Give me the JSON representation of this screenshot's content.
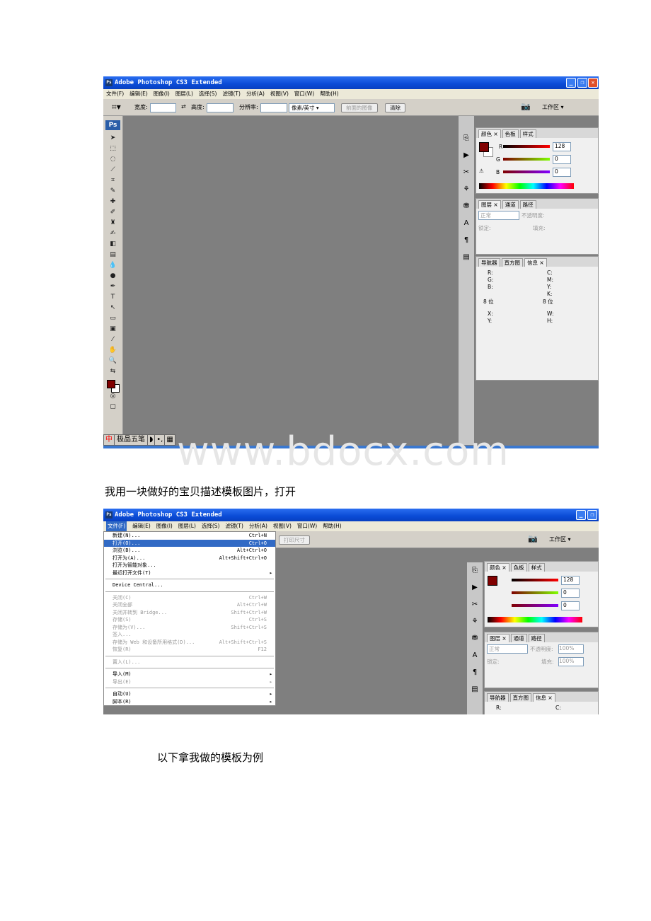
{
  "shot1": {
    "title": "Adobe Photoshop CS3 Extended",
    "menu": [
      "文件(F)",
      "编辑(E)",
      "图像(I)",
      "图层(L)",
      "选择(S)",
      "滤镜(T)",
      "分析(A)",
      "视图(V)",
      "窗口(W)",
      "帮助(H)"
    ],
    "options": {
      "width_label": "宽度:",
      "height_label": "高度:",
      "resolution_label": "分辨率:",
      "unit": "像素/英寸",
      "front_image": "前面的图像",
      "clear": "清除",
      "workspace": "工作区 ▾"
    },
    "ps_logo": "Ps",
    "color_panel": {
      "tabs": [
        "颜色 ×",
        "色板",
        "样式"
      ],
      "r_label": "R",
      "g_label": "G",
      "b_label": "B",
      "r": "128",
      "g": "0",
      "b": "0"
    },
    "layers_panel": {
      "tabs": [
        "图层 ×",
        "通道",
        "路径"
      ],
      "mode": "正常",
      "opacity_label": "不透明度:",
      "lock_label": "锁定:",
      "fill_label": "填充:"
    },
    "info_panel": {
      "tabs": [
        "导航器",
        "直方图",
        "信息 ×"
      ],
      "rgb": "R:\nG:\nB:",
      "cmyk": "C:\nM:\nY:\nK:",
      "bits1": "8 位",
      "bits2": "8 位",
      "xy": "X:\nY:",
      "wh": "W:\nH:"
    },
    "ime": {
      "zh": "中",
      "name": "极品五笔"
    }
  },
  "watermark": "www.bdocx.com",
  "para1": "我用一块做好的宝贝描述模板图片，打开",
  "shot2": {
    "title": "Adobe Photoshop CS3 Extended",
    "menu": [
      "文件(F)",
      "编辑(E)",
      "图像(I)",
      "图层(L)",
      "选择(S)",
      "滤镜(T)",
      "分析(A)",
      "视图(V)",
      "窗口(W)",
      "帮助(H)"
    ],
    "print_size": "打印尺寸",
    "workspace": "工作区 ▾",
    "file_menu": [
      {
        "label": "新建(N)...",
        "shortcut": "Ctrl+N"
      },
      {
        "label": "打开(O)...",
        "shortcut": "Ctrl+O",
        "highlighted": true
      },
      {
        "label": "浏览(B)...",
        "shortcut": "Alt+Ctrl+O"
      },
      {
        "label": "打开为(A)...",
        "shortcut": "Alt+Shift+Ctrl+O"
      },
      {
        "label": "打开为智能对象..."
      },
      {
        "label": "最近打开文件(T)",
        "submenu": true
      },
      {
        "sep": true
      },
      {
        "label": "Device Central..."
      },
      {
        "sep": true
      },
      {
        "label": "关闭(C)",
        "shortcut": "Ctrl+W",
        "disabled": true
      },
      {
        "label": "关闭全部",
        "shortcut": "Alt+Ctrl+W",
        "disabled": true
      },
      {
        "label": "关闭并转到 Bridge...",
        "shortcut": "Shift+Ctrl+W",
        "disabled": true
      },
      {
        "label": "存储(S)",
        "shortcut": "Ctrl+S",
        "disabled": true
      },
      {
        "label": "存储为(V)...",
        "shortcut": "Shift+Ctrl+S",
        "disabled": true
      },
      {
        "label": "签入...",
        "disabled": true
      },
      {
        "label": "存储为 Web 和设备所用格式(D)...",
        "shortcut": "Alt+Shift+Ctrl+S",
        "disabled": true
      },
      {
        "label": "恢复(R)",
        "shortcut": "F12",
        "disabled": true
      },
      {
        "sep": true
      },
      {
        "label": "置入(L)...",
        "disabled": true
      },
      {
        "sep": true
      },
      {
        "label": "导入(M)",
        "submenu": true
      },
      {
        "label": "导出(E)",
        "submenu": true,
        "disabled": true
      },
      {
        "sep": true
      },
      {
        "label": "自动(U)",
        "submenu": true
      },
      {
        "label": "脚本(R)",
        "submenu": true
      }
    ],
    "color_panel": {
      "tabs": [
        "颜色 ×",
        "色板",
        "样式"
      ],
      "r": "128",
      "g": "0",
      "b": "0"
    },
    "layers_panel": {
      "tabs": [
        "图层 ×",
        "通道",
        "路径"
      ],
      "mode": "正常",
      "opacity_label": "不透明度:",
      "opacity": "100%",
      "lock_label": "锁定:",
      "fill_label": "填充:",
      "fill": "100%"
    },
    "info_panel": {
      "tabs": [
        "导航器",
        "直方图",
        "信息 ×"
      ],
      "r": "R:",
      "c": "C:"
    }
  },
  "para2": "以下拿我做的模板为例"
}
